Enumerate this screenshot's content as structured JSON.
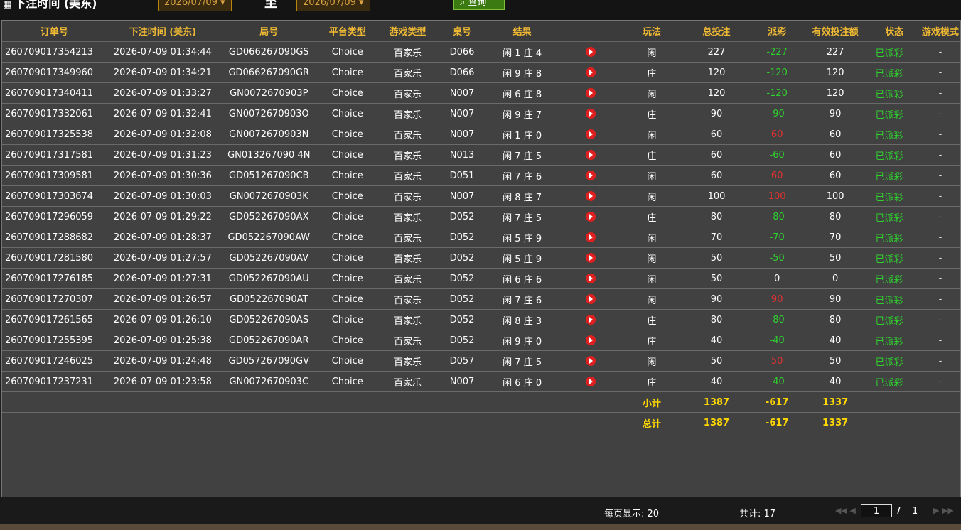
{
  "header": {
    "title": "下注时间 (美东)",
    "date_from": "2026/07/09 ▾",
    "separator": "至",
    "date_to": "2026/07/09 ▾",
    "query_button": "查询"
  },
  "colors": {
    "accent": "#f0b933",
    "negative": "#2ed22e",
    "positive": "#e23030",
    "subtotal": "#ffd700"
  },
  "table": {
    "columns": [
      "订单号",
      "下注时间 (美东)",
      "局号",
      "平台类型",
      "游戏类型",
      "桌号",
      "结果",
      "",
      "玩法",
      "总投注",
      "派彩",
      "有效投注额",
      "状态",
      "游戏模式"
    ],
    "rows": [
      {
        "order": "260709017354213",
        "time": "2026-07-09 01:34:44",
        "round": "GD066267090GS",
        "platform": "Choice",
        "game": "百家乐",
        "table": "D066",
        "result": "闲 1 庄 4",
        "play": "闲",
        "bet": "227",
        "payout": "-227",
        "payout_sign": "neg",
        "valid": "227",
        "status": "已派彩",
        "mode": "-"
      },
      {
        "order": "260709017349960",
        "time": "2026-07-09 01:34:21",
        "round": "GD066267090GR",
        "platform": "Choice",
        "game": "百家乐",
        "table": "D066",
        "result": "闲 9 庄 8",
        "play": "庄",
        "bet": "120",
        "payout": "-120",
        "payout_sign": "neg",
        "valid": "120",
        "status": "已派彩",
        "mode": "-"
      },
      {
        "order": "260709017340411",
        "time": "2026-07-09 01:33:27",
        "round": "GN0072670903P",
        "platform": "Choice",
        "game": "百家乐",
        "table": "N007",
        "result": "闲 6 庄 8",
        "play": "闲",
        "bet": "120",
        "payout": "-120",
        "payout_sign": "neg",
        "valid": "120",
        "status": "已派彩",
        "mode": "-"
      },
      {
        "order": "260709017332061",
        "time": "2026-07-09 01:32:41",
        "round": "GN0072670903O",
        "platform": "Choice",
        "game": "百家乐",
        "table": "N007",
        "result": "闲 9 庄 7",
        "play": "庄",
        "bet": "90",
        "payout": "-90",
        "payout_sign": "neg",
        "valid": "90",
        "status": "已派彩",
        "mode": "-"
      },
      {
        "order": "260709017325538",
        "time": "2026-07-09 01:32:08",
        "round": "GN0072670903N",
        "platform": "Choice",
        "game": "百家乐",
        "table": "N007",
        "result": "闲 1 庄 0",
        "play": "闲",
        "bet": "60",
        "payout": "60",
        "payout_sign": "pos",
        "valid": "60",
        "status": "已派彩",
        "mode": "-"
      },
      {
        "order": "260709017317581",
        "time": "2026-07-09 01:31:23",
        "round": "GN013267090 4N",
        "platform": "Choice",
        "game": "百家乐",
        "table": "N013",
        "result": "闲 7 庄 5",
        "play": "庄",
        "bet": "60",
        "payout": "-60",
        "payout_sign": "neg",
        "valid": "60",
        "status": "已派彩",
        "mode": "-"
      },
      {
        "order": "260709017309581",
        "time": "2026-07-09 01:30:36",
        "round": "GD051267090CB",
        "platform": "Choice",
        "game": "百家乐",
        "table": "D051",
        "result": "闲 7 庄 6",
        "play": "闲",
        "bet": "60",
        "payout": "60",
        "payout_sign": "pos",
        "valid": "60",
        "status": "已派彩",
        "mode": "-"
      },
      {
        "order": "260709017303674",
        "time": "2026-07-09 01:30:03",
        "round": "GN0072670903K",
        "platform": "Choice",
        "game": "百家乐",
        "table": "N007",
        "result": "闲 8 庄 7",
        "play": "闲",
        "bet": "100",
        "payout": "100",
        "payout_sign": "pos",
        "valid": "100",
        "status": "已派彩",
        "mode": "-"
      },
      {
        "order": "260709017296059",
        "time": "2026-07-09 01:29:22",
        "round": "GD052267090AX",
        "platform": "Choice",
        "game": "百家乐",
        "table": "D052",
        "result": "闲 7 庄 5",
        "play": "庄",
        "bet": "80",
        "payout": "-80",
        "payout_sign": "neg",
        "valid": "80",
        "status": "已派彩",
        "mode": "-"
      },
      {
        "order": "260709017288682",
        "time": "2026-07-09 01:28:37",
        "round": "GD052267090AW",
        "platform": "Choice",
        "game": "百家乐",
        "table": "D052",
        "result": "闲 5 庄 9",
        "play": "闲",
        "bet": "70",
        "payout": "-70",
        "payout_sign": "neg",
        "valid": "70",
        "status": "已派彩",
        "mode": "-"
      },
      {
        "order": "260709017281580",
        "time": "2026-07-09 01:27:57",
        "round": "GD052267090AV",
        "platform": "Choice",
        "game": "百家乐",
        "table": "D052",
        "result": "闲 5 庄 9",
        "play": "闲",
        "bet": "50",
        "payout": "-50",
        "payout_sign": "neg",
        "valid": "50",
        "status": "已派彩",
        "mode": "-"
      },
      {
        "order": "260709017276185",
        "time": "2026-07-09 01:27:31",
        "round": "GD052267090AU",
        "platform": "Choice",
        "game": "百家乐",
        "table": "D052",
        "result": "闲 6 庄 6",
        "play": "闲",
        "bet": "50",
        "payout": "0",
        "payout_sign": "zero",
        "valid": "0",
        "status": "已派彩",
        "mode": "-"
      },
      {
        "order": "260709017270307",
        "time": "2026-07-09 01:26:57",
        "round": "GD052267090AT",
        "platform": "Choice",
        "game": "百家乐",
        "table": "D052",
        "result": "闲 7 庄 6",
        "play": "闲",
        "bet": "90",
        "payout": "90",
        "payout_sign": "pos",
        "valid": "90",
        "status": "已派彩",
        "mode": "-"
      },
      {
        "order": "260709017261565",
        "time": "2026-07-09 01:26:10",
        "round": "GD052267090AS",
        "platform": "Choice",
        "game": "百家乐",
        "table": "D052",
        "result": "闲 8 庄 3",
        "play": "庄",
        "bet": "80",
        "payout": "-80",
        "payout_sign": "neg",
        "valid": "80",
        "status": "已派彩",
        "mode": "-"
      },
      {
        "order": "260709017255395",
        "time": "2026-07-09 01:25:38",
        "round": "GD052267090AR",
        "platform": "Choice",
        "game": "百家乐",
        "table": "D052",
        "result": "闲 9 庄 0",
        "play": "庄",
        "bet": "40",
        "payout": "-40",
        "payout_sign": "neg",
        "valid": "40",
        "status": "已派彩",
        "mode": "-"
      },
      {
        "order": "260709017246025",
        "time": "2026-07-09 01:24:48",
        "round": "GD057267090GV",
        "platform": "Choice",
        "game": "百家乐",
        "table": "D057",
        "result": "闲 7 庄 5",
        "play": "闲",
        "bet": "50",
        "payout": "50",
        "payout_sign": "pos",
        "valid": "50",
        "status": "已派彩",
        "mode": "-"
      },
      {
        "order": "260709017237231",
        "time": "2026-07-09 01:23:58",
        "round": "GN0072670903C",
        "platform": "Choice",
        "game": "百家乐",
        "table": "N007",
        "result": "闲 6 庄 0",
        "play": "庄",
        "bet": "40",
        "payout": "-40",
        "payout_sign": "neg",
        "valid": "40",
        "status": "已派彩",
        "mode": "-"
      }
    ],
    "subtotal": {
      "label": "小计",
      "bet": "1387",
      "payout": "-617",
      "valid": "1337"
    },
    "total": {
      "label": "总计",
      "bet": "1387",
      "payout": "-617",
      "valid": "1337"
    }
  },
  "footer": {
    "per_page": "每页显示: 20",
    "total_count": "共计: 17",
    "first_prev": "◀◀  ◀",
    "current_page": "1",
    "slash": "/",
    "total_pages": "1",
    "next_last": "▶  ▶▶"
  }
}
